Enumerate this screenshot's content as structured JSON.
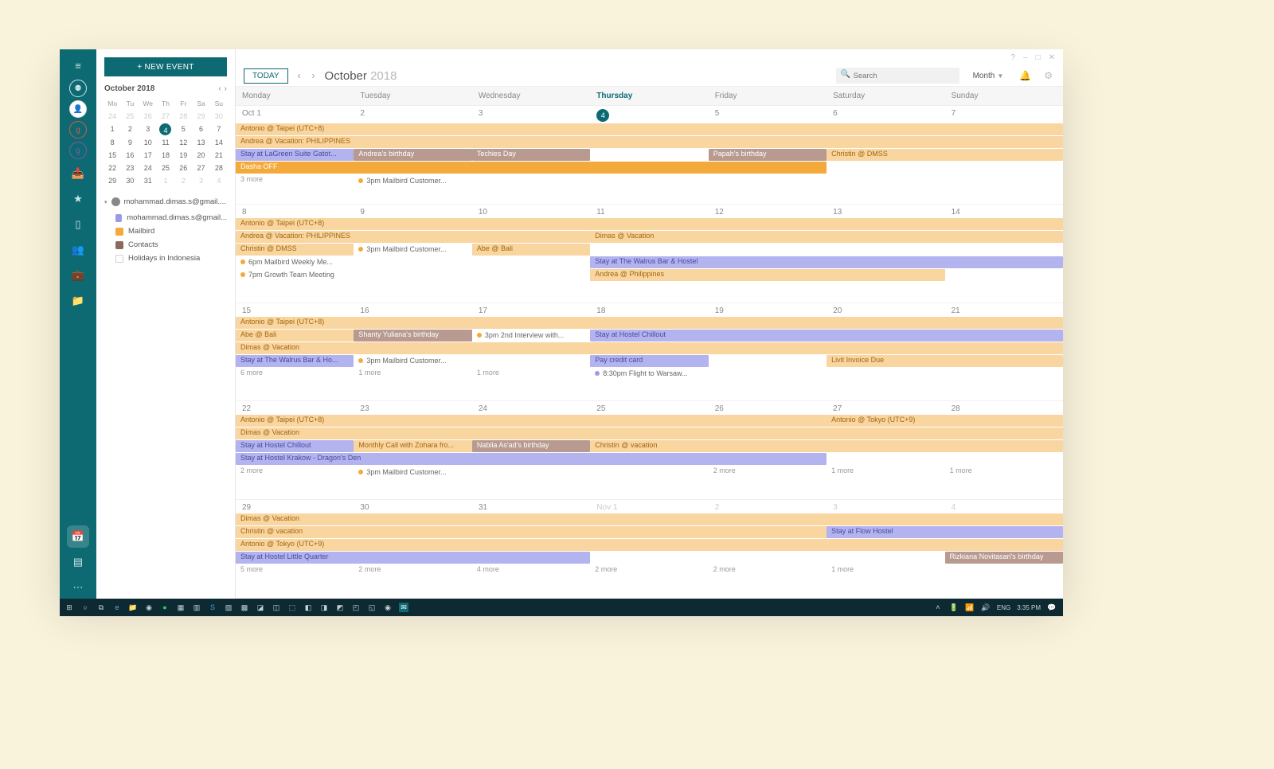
{
  "window": {
    "help": "?",
    "min": "–",
    "max": "□",
    "close": "✕"
  },
  "rail": {
    "items": [
      "menu",
      "groups",
      "profile",
      "g-red",
      "g-purple",
      "inbox",
      "star",
      "doc",
      "contacts",
      "briefcase",
      "folder"
    ],
    "bottom": [
      "calendar",
      "list",
      "more"
    ]
  },
  "sidebar": {
    "new_event": "+ NEW EVENT",
    "mini_month": "October 2018",
    "dow": [
      "Mo",
      "Tu",
      "We",
      "Th",
      "Fr",
      "Sa",
      "Su"
    ],
    "prev_trail": [
      24,
      25,
      26,
      27,
      28,
      29,
      30
    ],
    "rows": [
      [
        1,
        2,
        3,
        4,
        5,
        6,
        7
      ],
      [
        8,
        9,
        10,
        11,
        12,
        13,
        14
      ],
      [
        15,
        16,
        17,
        18,
        19,
        20,
        21
      ],
      [
        22,
        23,
        24,
        25,
        26,
        27,
        28
      ],
      [
        29,
        30,
        31,
        1,
        2,
        3,
        4
      ]
    ],
    "today": 4,
    "account": "mohammad.dimas.s@gmail....",
    "cals": [
      {
        "label": "mohammad.dimas.s@gmail...",
        "cls": "blue"
      },
      {
        "label": "Mailbird",
        "cls": "or"
      },
      {
        "label": "Contacts",
        "cls": "br"
      },
      {
        "label": "Holidays in Indonesia",
        "cls": "empty"
      }
    ]
  },
  "topbar": {
    "today": "TODAY",
    "month": "October",
    "year": "2018",
    "search_placeholder": "Search",
    "view": "Month"
  },
  "dow_full": [
    "Monday",
    "Tuesday",
    "Wednesday",
    "Thursday",
    "Friday",
    "Saturday",
    "Sunday"
  ],
  "weeks": [
    {
      "dates": [
        {
          "t": "Oct 1"
        },
        {
          "t": "2"
        },
        {
          "t": "3"
        },
        {
          "t": "4",
          "today": true
        },
        {
          "t": "5"
        },
        {
          "t": "6"
        },
        {
          "t": "7"
        }
      ],
      "lanes": [
        [
          {
            "s": 1,
            "e": 8,
            "cls": "or",
            "t": "Antonio @ Taipei (UTC+8)"
          }
        ],
        [
          {
            "s": 1,
            "e": 8,
            "cls": "or",
            "t": "Andrea @ Vacation: PHILIPPINES"
          }
        ],
        [
          {
            "s": 1,
            "e": 2,
            "cls": "pu",
            "t": "Stay at LaGreen Suite Gatot..."
          },
          {
            "s": 2,
            "e": 3,
            "cls": "br",
            "t": "Andrea's birthday"
          },
          {
            "s": 3,
            "e": 4,
            "cls": "br",
            "t": "Techies Day"
          },
          {
            "s": 5,
            "e": 6,
            "cls": "br",
            "t": "Papah's birthday"
          },
          {
            "s": 6,
            "e": 8,
            "cls": "or",
            "t": "Christin @ DMSS"
          }
        ],
        [
          {
            "s": 1,
            "e": 6,
            "cls": "or2",
            "t": "Dasha OFF"
          }
        ],
        [
          {
            "s": 1,
            "e": 2,
            "cls": "more",
            "t": "3 more"
          },
          {
            "s": 2,
            "e": 3,
            "cls": "timed",
            "dot": "or",
            "t": "3pm Mailbird Customer..."
          }
        ]
      ]
    },
    {
      "dates": [
        {
          "t": "8"
        },
        {
          "t": "9"
        },
        {
          "t": "10"
        },
        {
          "t": "11"
        },
        {
          "t": "12"
        },
        {
          "t": "13"
        },
        {
          "t": "14"
        }
      ],
      "lanes": [
        [
          {
            "s": 1,
            "e": 8,
            "cls": "or",
            "t": "Antonio @ Taipei (UTC+8)"
          }
        ],
        [
          {
            "s": 1,
            "e": 4,
            "cls": "or",
            "t": "Andrea @ Vacation: PHILIPPINES"
          },
          {
            "s": 4,
            "e": 8,
            "cls": "or",
            "t": "Dimas @ Vacation"
          }
        ],
        [
          {
            "s": 1,
            "e": 2,
            "cls": "or",
            "t": "Christin @ DMSS"
          },
          {
            "s": 2,
            "e": 3,
            "cls": "timed",
            "dot": "or",
            "t": "3pm Mailbird Customer..."
          },
          {
            "s": 3,
            "e": 4,
            "cls": "or",
            "t": "Abe @ Bali"
          }
        ],
        [
          {
            "s": 1,
            "e": 2,
            "cls": "timed",
            "dot": "or",
            "t": "6pm Mailbird Weekly Me..."
          },
          {
            "s": 4,
            "e": 8,
            "cls": "pu",
            "t": "Stay at The Walrus Bar & Hostel"
          }
        ],
        [
          {
            "s": 1,
            "e": 2,
            "cls": "timed",
            "dot": "or",
            "t": "7pm Growth Team Meeting"
          },
          {
            "s": 4,
            "e": 7,
            "cls": "or",
            "t": "Andrea @ Philippines"
          }
        ]
      ]
    },
    {
      "dates": [
        {
          "t": "15"
        },
        {
          "t": "16"
        },
        {
          "t": "17"
        },
        {
          "t": "18"
        },
        {
          "t": "19"
        },
        {
          "t": "20"
        },
        {
          "t": "21"
        }
      ],
      "lanes": [
        [
          {
            "s": 1,
            "e": 8,
            "cls": "or",
            "t": "Antonio @ Taipei (UTC+8)"
          }
        ],
        [
          {
            "s": 1,
            "e": 2,
            "cls": "or",
            "t": "Abe @ Bali"
          },
          {
            "s": 2,
            "e": 3,
            "cls": "br",
            "t": "Shanty Yuliana's birthday"
          },
          {
            "s": 3,
            "e": 4,
            "cls": "timed",
            "dot": "or",
            "t": "3pm 2nd Interview with..."
          },
          {
            "s": 4,
            "e": 8,
            "cls": "pu",
            "t": "Stay at Hostel Chillout"
          }
        ],
        [
          {
            "s": 1,
            "e": 8,
            "cls": "or",
            "t": "Dimas @ Vacation"
          }
        ],
        [
          {
            "s": 1,
            "e": 2,
            "cls": "pu",
            "t": "Stay at The Walrus Bar & Ho..."
          },
          {
            "s": 2,
            "e": 3,
            "cls": "timed",
            "dot": "or",
            "t": "3pm Mailbird Customer..."
          },
          {
            "s": 4,
            "e": 5,
            "cls": "pu",
            "t": "Pay credit card"
          },
          {
            "s": 6,
            "e": 8,
            "cls": "or",
            "t": "Livit Invoice Due"
          }
        ],
        [
          {
            "s": 1,
            "e": 2,
            "cls": "more",
            "t": "6 more"
          },
          {
            "s": 2,
            "e": 3,
            "cls": "more",
            "t": "1 more"
          },
          {
            "s": 3,
            "e": 4,
            "cls": "more",
            "t": "1 more"
          },
          {
            "s": 4,
            "e": 5,
            "cls": "timed",
            "dot": "pu",
            "t": "8:30pm Flight to Warsaw..."
          }
        ]
      ]
    },
    {
      "dates": [
        {
          "t": "22"
        },
        {
          "t": "23"
        },
        {
          "t": "24"
        },
        {
          "t": "25"
        },
        {
          "t": "26"
        },
        {
          "t": "27"
        },
        {
          "t": "28"
        }
      ],
      "lanes": [
        [
          {
            "s": 1,
            "e": 6,
            "cls": "or",
            "t": "Antonio @ Taipei (UTC+8)"
          },
          {
            "s": 6,
            "e": 8,
            "cls": "or",
            "t": "Antonio @ Tokyo (UTC+9)"
          }
        ],
        [
          {
            "s": 1,
            "e": 8,
            "cls": "or",
            "t": "Dimas @ Vacation"
          }
        ],
        [
          {
            "s": 1,
            "e": 2,
            "cls": "pu",
            "t": "Stay at Hostel Chillout"
          },
          {
            "s": 2,
            "e": 3,
            "cls": "or",
            "t": "Monthly Call with Zohara fro..."
          },
          {
            "s": 3,
            "e": 4,
            "cls": "br",
            "t": "Nabila As'ad's birthday"
          },
          {
            "s": 4,
            "e": 8,
            "cls": "or",
            "t": "Christin @ vacation"
          }
        ],
        [
          {
            "s": 1,
            "e": 6,
            "cls": "pu",
            "t": "Stay at Hostel Krakow - Dragon's Den"
          }
        ],
        [
          {
            "s": 1,
            "e": 2,
            "cls": "more",
            "t": "2 more"
          },
          {
            "s": 2,
            "e": 3,
            "cls": "timed",
            "dot": "or",
            "t": "3pm Mailbird Customer..."
          },
          {
            "s": 5,
            "e": 6,
            "cls": "more",
            "t": "2 more"
          },
          {
            "s": 6,
            "e": 7,
            "cls": "more",
            "t": "1 more"
          },
          {
            "s": 7,
            "e": 8,
            "cls": "more",
            "t": "1 more"
          }
        ]
      ]
    },
    {
      "dates": [
        {
          "t": "29"
        },
        {
          "t": "30"
        },
        {
          "t": "31"
        },
        {
          "t": "Nov 1",
          "np": true
        },
        {
          "t": "2",
          "np": true
        },
        {
          "t": "3",
          "np": true
        },
        {
          "t": "4",
          "np": true
        }
      ],
      "lanes": [
        [
          {
            "s": 1,
            "e": 8,
            "cls": "or",
            "t": "Dimas @ Vacation"
          }
        ],
        [
          {
            "s": 1,
            "e": 6,
            "cls": "or",
            "t": "Christin @ vacation"
          },
          {
            "s": 6,
            "e": 8,
            "cls": "pu",
            "t": "Stay at Flow Hostel"
          }
        ],
        [
          {
            "s": 1,
            "e": 8,
            "cls": "or",
            "t": "Antonio @ Tokyo (UTC+9)"
          }
        ],
        [
          {
            "s": 1,
            "e": 4,
            "cls": "pu",
            "t": "Stay at Hostel Little Quarter"
          },
          {
            "s": 7,
            "e": 8,
            "cls": "br",
            "t": "Rizkiana Novitasari's birthday"
          }
        ],
        [
          {
            "s": 1,
            "e": 2,
            "cls": "more",
            "t": "5 more"
          },
          {
            "s": 2,
            "e": 3,
            "cls": "more",
            "t": "2 more"
          },
          {
            "s": 3,
            "e": 4,
            "cls": "more",
            "t": "4 more"
          },
          {
            "s": 4,
            "e": 5,
            "cls": "more",
            "t": "2 more"
          },
          {
            "s": 5,
            "e": 6,
            "cls": "more",
            "t": "2 more"
          },
          {
            "s": 6,
            "e": 7,
            "cls": "more",
            "t": "1 more"
          }
        ]
      ]
    }
  ],
  "taskbar": {
    "lang": "ENG",
    "time": "3:35 PM"
  }
}
